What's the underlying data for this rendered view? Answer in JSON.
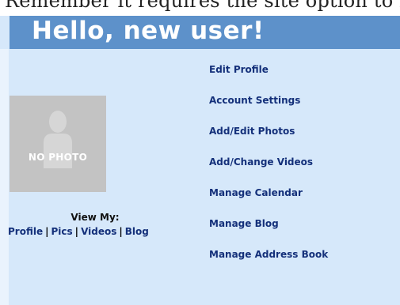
{
  "top_fragment": "Remember it requires the site option to be on",
  "header": {
    "title": "Hello, new user!"
  },
  "photo": {
    "placeholder_text": "NO PHOTO"
  },
  "view_my": {
    "label": "View My:",
    "links": [
      "Profile",
      "Pics",
      "Videos",
      "Blog"
    ],
    "separator": "|"
  },
  "menu": {
    "items": [
      "Edit Profile",
      "Account Settings",
      "Add/Edit Photos",
      "Add/Change Videos",
      "Manage Calendar",
      "Manage Blog",
      "Manage Address Book"
    ]
  },
  "colors": {
    "header_bar": "#5d91ca",
    "panel_bg": "#d6e8fa",
    "link": "#14307a",
    "photo_bg": "#c3c3c3"
  }
}
